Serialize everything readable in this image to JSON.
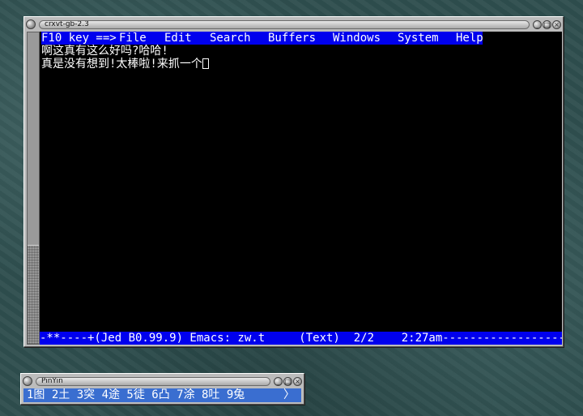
{
  "terminal_window": {
    "title": "crxvt-gb-2.3",
    "controls": [
      "_",
      "□",
      "×"
    ]
  },
  "editor": {
    "menubar": {
      "prefix": "F10 key ==>",
      "items": [
        "File",
        "Edit",
        "Search",
        "Buffers",
        "Windows",
        "System",
        "Help"
      ]
    },
    "lines": [
      "啊这真有这么好吗?哈哈!",
      "真是没有想到!太棒啦!来抓一个"
    ],
    "statusline": "-**----+(Jed B0.99.9) Emacs: zw.t     (Text)  2/2    2:27am-----------------------"
  },
  "ime_window": {
    "title": "PinYin",
    "controls": [
      "_",
      "□",
      "×"
    ],
    "candidates": "1图 2土 3突 4途 5徒 6凸 7涂 8吐 9兔",
    "next_page": "〉"
  },
  "colors": {
    "terminal_bg": "#000000",
    "terminal_fg": "#ffffff",
    "menubar_bg": "#0000ee",
    "ime_bar_bg": "#3a6ed0",
    "frame": "#bcbcbc"
  }
}
